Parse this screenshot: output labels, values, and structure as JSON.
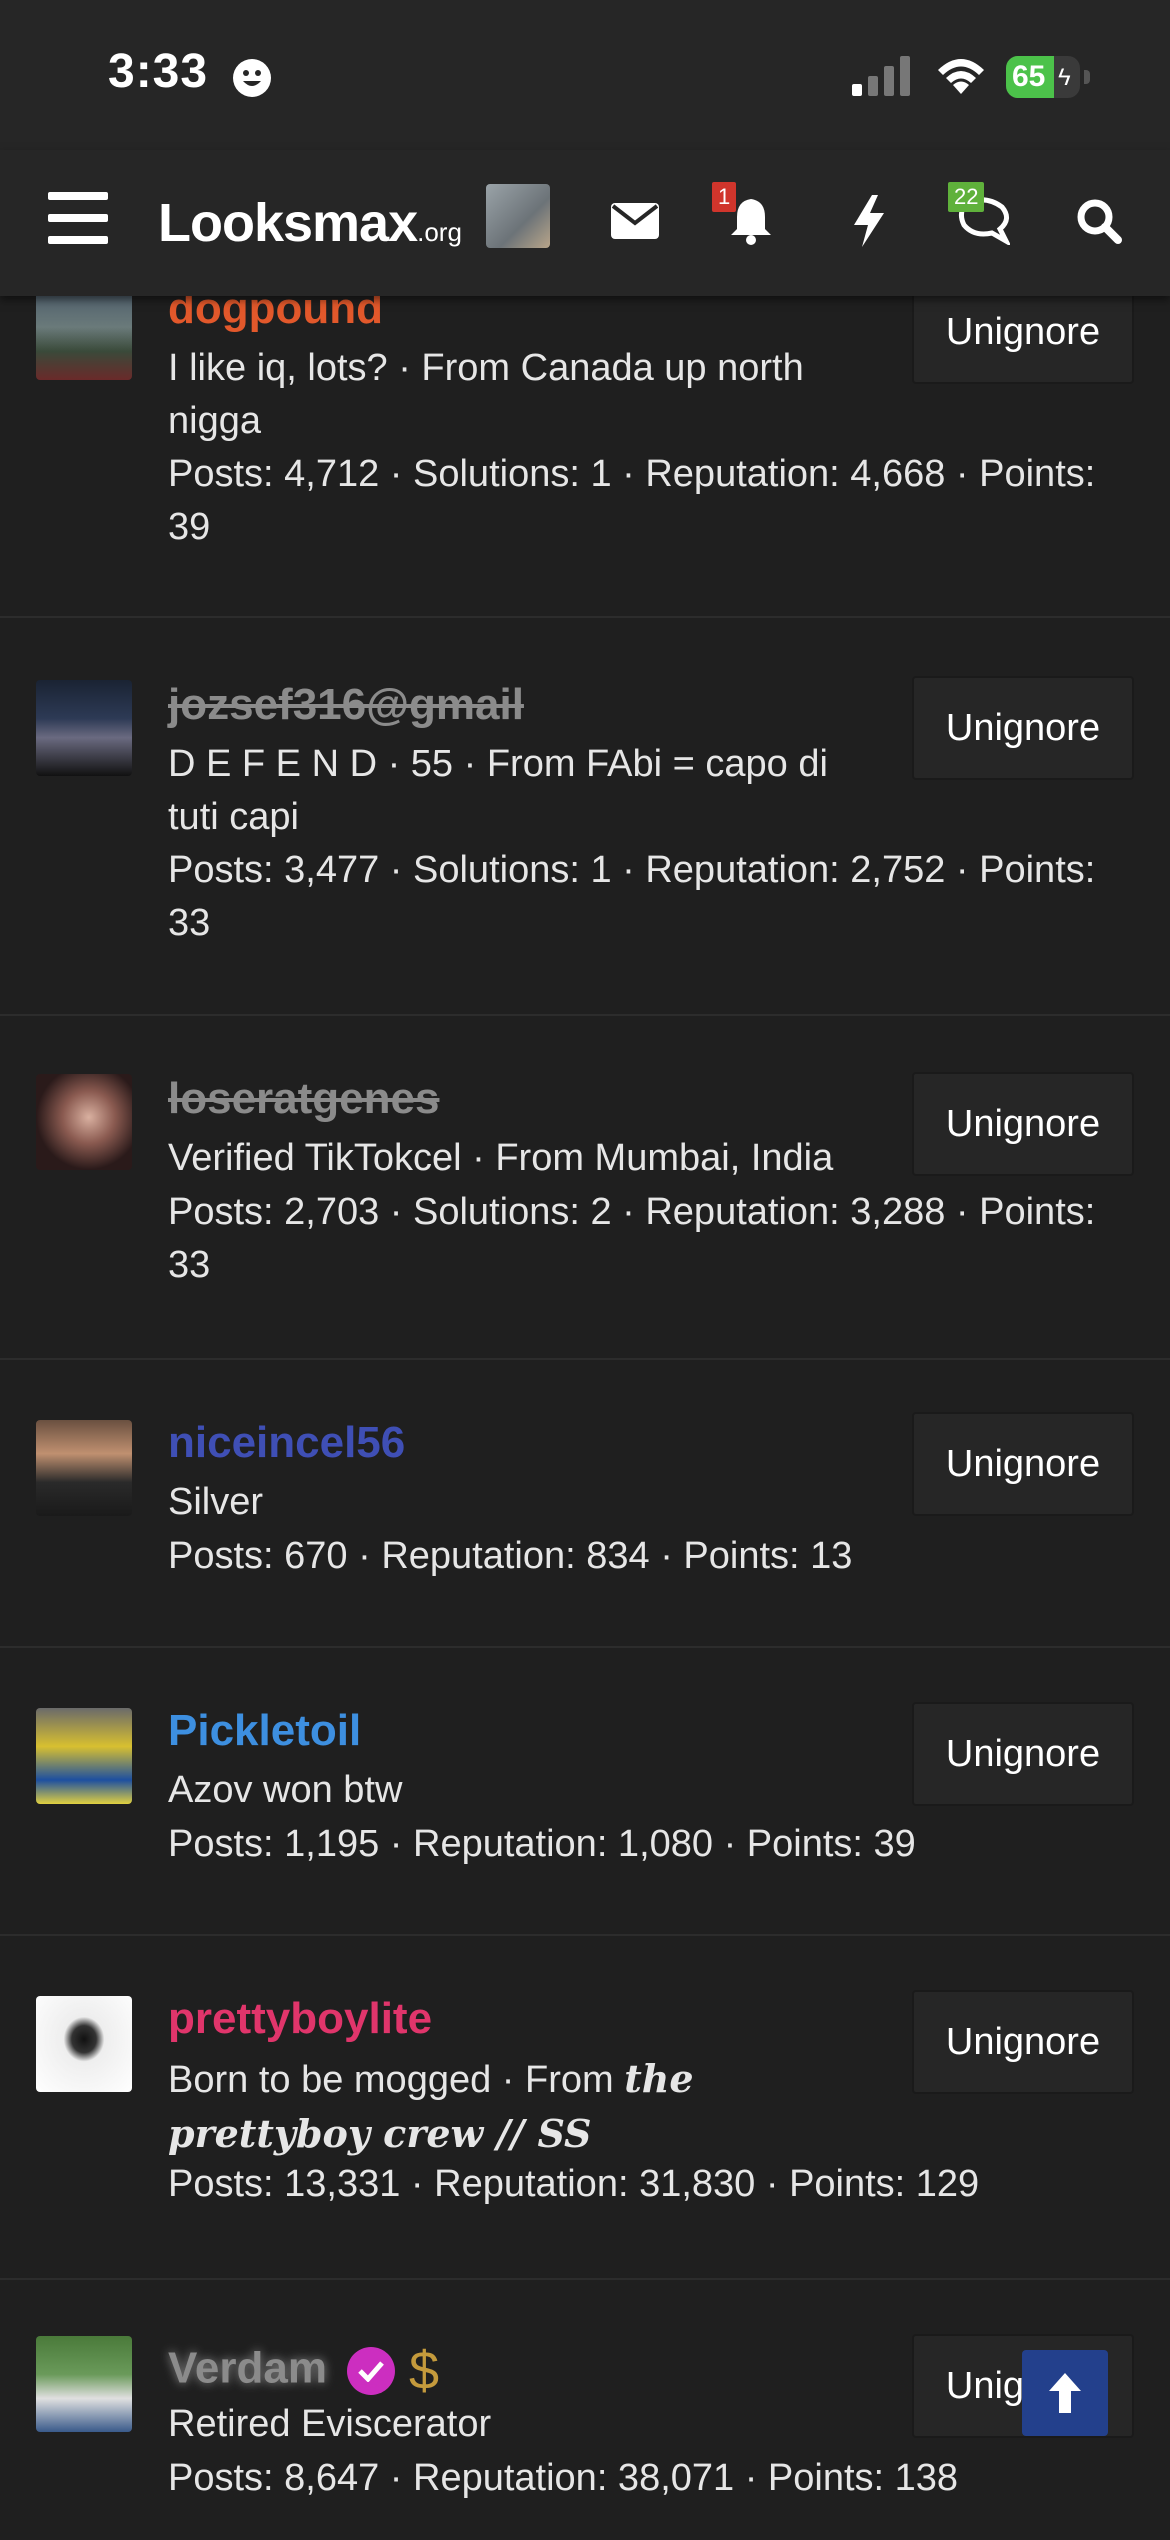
{
  "status": {
    "time": "3:33",
    "battery_percent": 65,
    "battery_label": "65"
  },
  "header": {
    "logo_main": "Looksmax",
    "logo_suffix": ".org",
    "notifications_badge": "1",
    "conversations_badge": "22"
  },
  "users": [
    {
      "name": "dogpound",
      "name_color": "#e2582b",
      "strikethrough": false,
      "desc_line1": "I like iq, lots? · From Canada up north",
      "desc_line2": "nigga",
      "stats_line1": "Posts: 4,712 · Solutions: 1 · Reputation: 4,668 · Points:",
      "stats_line2": "39",
      "button": "Unignore"
    },
    {
      "name": "jozsef316@gmail",
      "name_color": "#8b8b8b",
      "strikethrough": true,
      "desc_line1": "D E F E N D · 55 · From FAbi = capo di",
      "desc_line2": "tuti capi",
      "stats_line1": "Posts: 3,477 · Solutions: 1 · Reputation: 2,752 · Points:",
      "stats_line2": "33",
      "button": "Unignore"
    },
    {
      "name": "loseratgenes",
      "name_color": "#8b8b8b",
      "strikethrough": true,
      "desc_line1": "Verified TikTokcel · From Mumbai, India",
      "stats_line1": "Posts: 2,703 · Solutions: 2 · Reputation: 3,288 · Points:",
      "stats_line2": "33",
      "button": "Unignore"
    },
    {
      "name": "niceincel56",
      "name_color": "#3f4fb5",
      "strikethrough": false,
      "desc_line1": "Silver",
      "stats_line1": "Posts: 670 · Reputation: 834 · Points: 13",
      "button": "Unignore"
    },
    {
      "name": "Pickletoil",
      "name_color": "#3d8fe0",
      "strikethrough": false,
      "desc_line1": "Azov won btw",
      "stats_line1": "Posts: 1,195 · Reputation: 1,080 · Points: 39",
      "button": "Unignore"
    },
    {
      "name": "prettyboylite",
      "name_color": "#e0356b",
      "strikethrough": false,
      "desc_line1_plain": "Born to be mogged · From ",
      "desc_line1_fancy": "the",
      "desc_line2_fancy": "prettyboy crew",
      "desc_line2_plain": " // SS",
      "stats_line1": "Posts: 13,331 · Reputation: 31,830 · Points: 129",
      "button": "Unignore"
    },
    {
      "name": "Verdam",
      "name_color": "#8b8b8b",
      "strikethrough": false,
      "desc_line1": "Retired Eviscerator",
      "stats_line1": "Posts: 8,647 · Reputation: 38,071 · Points: 138",
      "button": "Unignore"
    }
  ],
  "icons": {
    "menu": "hamburger-icon",
    "messages": "envelope-icon",
    "alerts": "bell-icon",
    "whats_new": "lightning-icon",
    "conversations": "chat-bubbles-icon",
    "search": "search-icon",
    "scroll_top": "arrow-up-icon"
  }
}
